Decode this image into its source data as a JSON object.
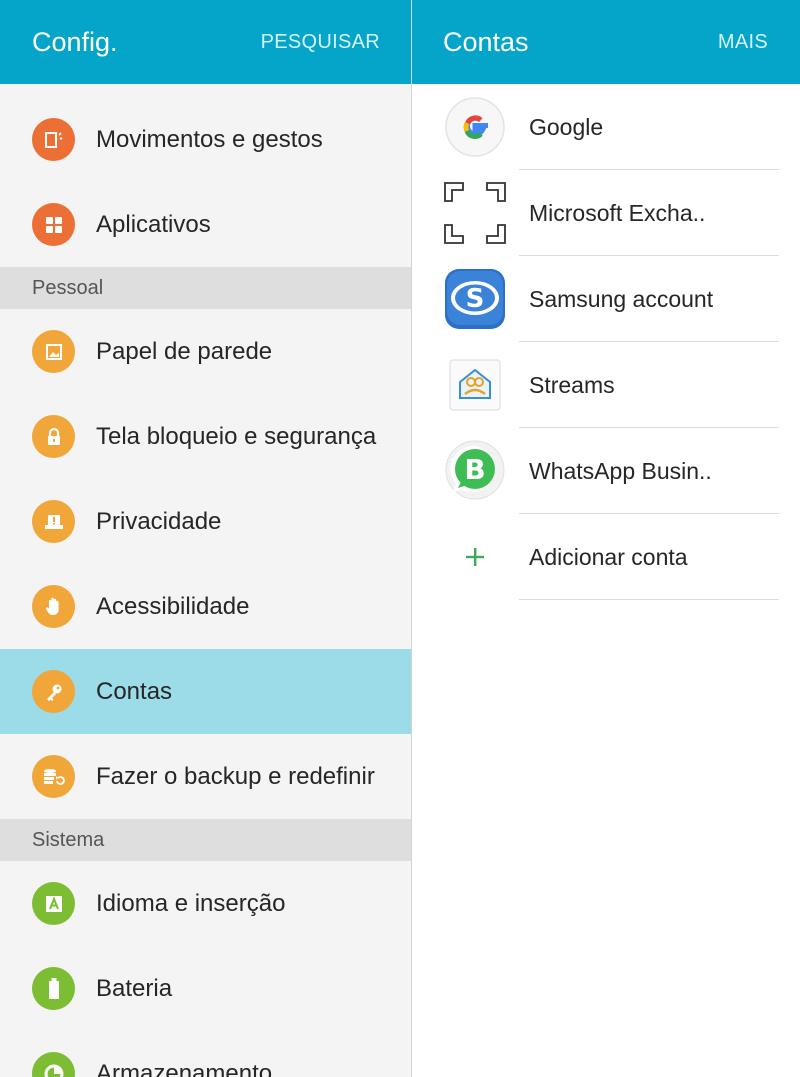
{
  "left_panel": {
    "title": "Config.",
    "action": "PESQUISAR",
    "items_top": [
      {
        "label": "Movimentos e gestos"
      },
      {
        "label": "Aplicativos"
      }
    ],
    "section_personal": "Pessoal",
    "items_personal": [
      {
        "label": "Papel de parede"
      },
      {
        "label": "Tela bloqueio e segurança"
      },
      {
        "label": "Privacidade"
      },
      {
        "label": "Acessibilidade"
      },
      {
        "label": "Contas",
        "selected": true
      },
      {
        "label": "Fazer o backup e redefinir"
      }
    ],
    "section_system": "Sistema",
    "items_system": [
      {
        "label": "Idioma e inserção"
      },
      {
        "label": "Bateria"
      },
      {
        "label": "Armazenamento"
      }
    ]
  },
  "right_panel": {
    "title": "Contas",
    "action": "MAIS",
    "accounts": [
      {
        "name": "Google"
      },
      {
        "name": "Microsoft Excha.."
      },
      {
        "name": "Samsung account"
      },
      {
        "name": "Streams"
      },
      {
        "name": "WhatsApp Busin.."
      },
      {
        "name": "Adicionar conta"
      }
    ]
  },
  "colors": {
    "app_bar": "#04a5c9",
    "selected_row": "#9bdce8",
    "icon_red": "#ec6f35",
    "icon_orange": "#f0a638",
    "icon_green": "#7cbd34"
  },
  "icons": {
    "movimentos": "gesture-icon",
    "aplicativos": "apps-grid-icon",
    "papel": "wallpaper-icon",
    "tela": "lock-icon",
    "privacidade": "privacy-alert-icon",
    "acessibilidade": "hand-icon",
    "contas": "key-icon",
    "backup": "backup-restore-icon",
    "idioma": "language-a-icon",
    "bateria": "battery-icon",
    "armazenamento": "storage-pie-icon",
    "google": "google-logo-icon",
    "exchange": "exchange-frame-icon",
    "samsung": "samsung-account-icon",
    "streams": "streams-icon",
    "whatsapp": "whatsapp-business-icon",
    "add": "plus-icon"
  }
}
